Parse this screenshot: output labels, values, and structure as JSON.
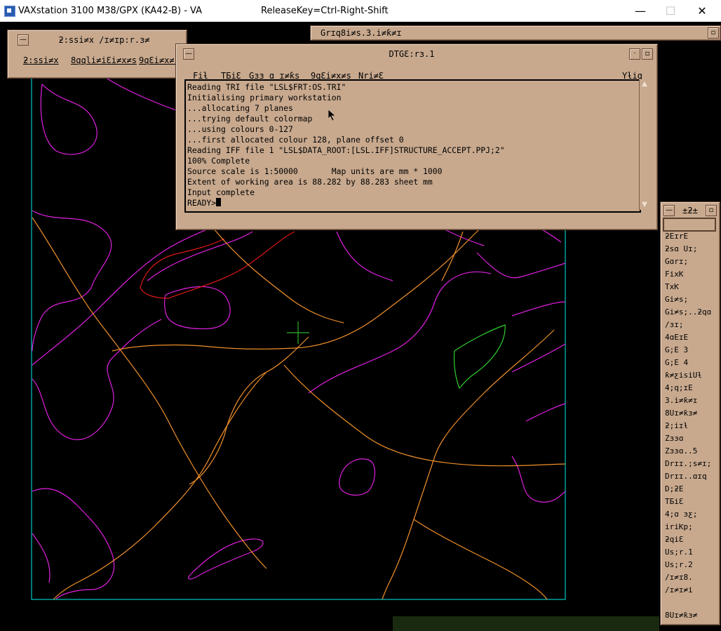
{
  "host_window": {
    "title": "VAXstation 3100 M38/GPX (KA42-B) - VA",
    "release_key": "ReleaseKey=Ctrl-Right-Shift",
    "minimize": "—",
    "maximize": "☐",
    "close": "✕"
  },
  "map": {
    "colors": {
      "background": "#000000",
      "frame": "#00c8c8",
      "magenta": "#e020e0",
      "orange": "#f0902a",
      "red": "#e01818",
      "green": "#30d030",
      "cursor": "#30b030"
    }
  },
  "left_window": {
    "title": "ƻ:ssi≠x /ɪ≠ɪp:r.ɜ≠",
    "menu": [
      "ƻ:ssi≠x",
      "8qqli≠iƐi≠x≠s",
      "9qƐi≠x≠s"
    ]
  },
  "back_window": {
    "title": "Grɪq8i≠s.3.i≠ƙ≠ɪ"
  },
  "main_window": {
    "title": "DTGƐ:rɜ.1",
    "menu": [
      "Fiƚ",
      "TƂiƐ",
      "Gɜɜ ɑ ɪ≠ƙs",
      "9qƐi≠x≠s",
      "Nri≠Ɛ"
    ],
    "help": "Yƚiq",
    "console_lines": [
      "Reading TRI file \"LSL$FRT:OS.TRI\"",
      "Initialising primary workstation",
      "...allocating 7 planes",
      "...trying default colormap",
      "...using colours 0-127",
      "...first allocated colour 128, plane offset 0",
      "Reading IFF file 1 \"LSL$DATA_ROOT:[LSL.IFF]STRUCTURE_ACCEPT.PPJ;2\"",
      "100% Complete",
      "Source scale is 1:50000       Map units are mm * 1000",
      "Extent of working area is 88.282 by 88.283 sheet mm",
      "Input complete"
    ],
    "prompt": "READY>"
  },
  "right_panel": {
    "title": "±ƻ±",
    "items": [
      "ƻEɪrE",
      "ƻsɑ Uɪ;",
      "Gɑrɪ;",
      "FixƘ",
      "TxƘ",
      "Gi≠s;",
      "Gi≠s;..ƻqɑ",
      "/ɜɪ;",
      "4ɑEɪE",
      "G;E 3",
      "G;E 4",
      "ƙ≠ƹisiUƚ",
      "4;q;ɪE",
      "3.i≠ƙ≠ɪ",
      "8Uɪ≠ƙɜ≠",
      "ƻ;iɪƚ",
      "Zɜɜɑ",
      "Zɜɜɑ..5",
      "Drɪɪ.;s≠ɪ;",
      "Drɪɪ..ɑɪq",
      "D;ƻE",
      "TƂiƐ",
      "4;ɑ ɜƹ;",
      "iriƘp;",
      "ƻqiƐ",
      "Us;r.1",
      "Us;r.2",
      "/ɪ≠ɪ8.",
      "/ɪ≠ɪ≠i"
    ],
    "footer": "8Uɪ≠ƙɜ≠"
  }
}
